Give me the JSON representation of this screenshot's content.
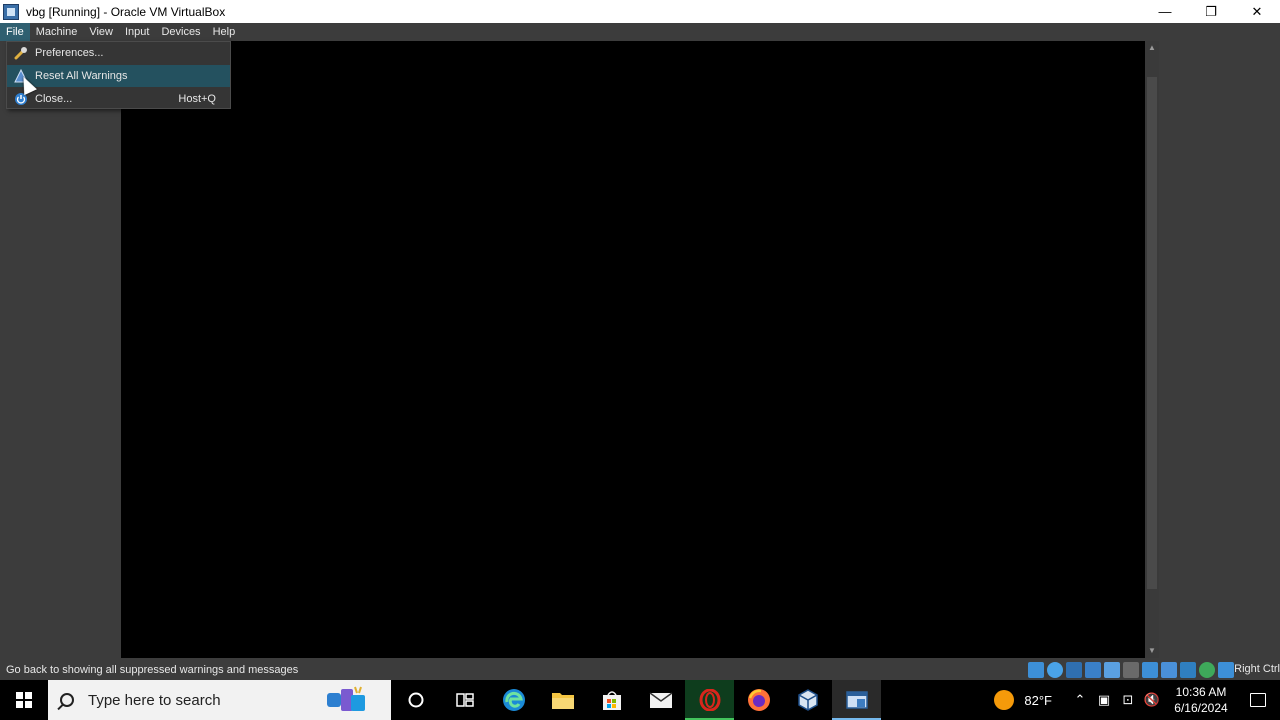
{
  "window": {
    "title": "vbg [Running] - Oracle VM VirtualBox",
    "controls": {
      "minimize": "—",
      "restore": "❐",
      "close": "✕"
    }
  },
  "menubar": {
    "items": [
      "File",
      "Machine",
      "View",
      "Input",
      "Devices",
      "Help"
    ],
    "active": "File"
  },
  "file_menu": {
    "items": [
      {
        "label": "Preferences...",
        "icon": "wrench-icon",
        "shortcut": ""
      },
      {
        "label": "Reset All Warnings",
        "icon": "warning-icon",
        "shortcut": "",
        "highlighted": true
      },
      {
        "label": "Close...",
        "icon": "power-icon",
        "shortcut": "Host+Q"
      }
    ]
  },
  "statusbar": {
    "message": "Go back to showing all suppressed warnings and messages",
    "host_key": "Right Ctrl"
  },
  "taskbar": {
    "search_placeholder": "Type here to search",
    "weather": "82°F",
    "time": "10:36 AM",
    "date": "6/16/2024"
  },
  "colors": {
    "menu_highlight": "#24515f",
    "vm_screen": "#000000",
    "chrome_bg": "#3c3c3c"
  }
}
